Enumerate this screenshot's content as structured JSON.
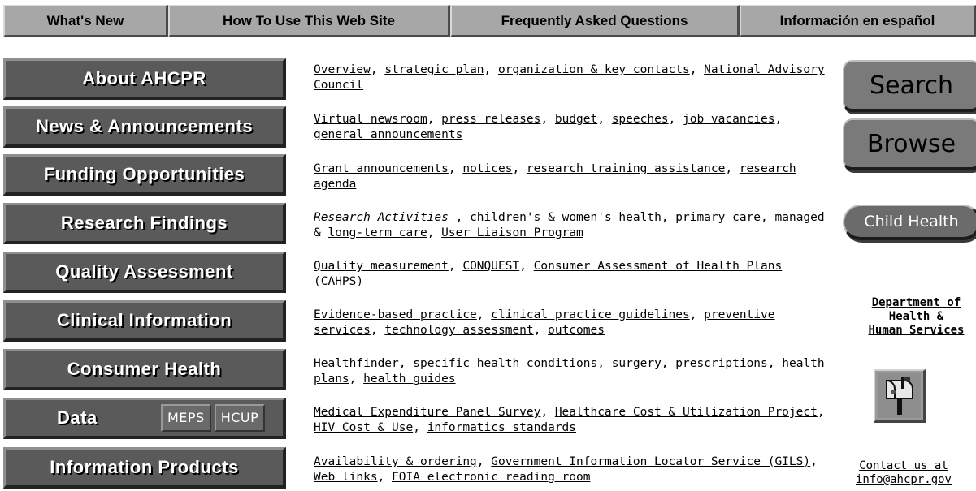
{
  "top_tabs": [
    {
      "label": "What's New"
    },
    {
      "label": "How To Use This Web Site"
    },
    {
      "label": "Frequently Asked Questions"
    },
    {
      "label": "Información en español"
    }
  ],
  "nav": {
    "about": "About AHCPR",
    "news": "News & Announcements",
    "funding": "Funding Opportunities",
    "research": "Research Findings",
    "quality": "Quality Assessment",
    "clinical": "Clinical Information",
    "consumer": "Consumer Health",
    "data": "Data",
    "meps": "MEPS",
    "hcup": "HCUP",
    "products": "Information Products"
  },
  "desc": {
    "about": {
      "l1": "Overview",
      "l2": "strategic plan",
      "l3": "organization & key contacts",
      "l4": "National Advisory Council"
    },
    "news": {
      "l1": "Virtual newsroom",
      "l2": "press releases",
      "l3": "budget",
      "l4": "speeches",
      "l5": "job vacancies",
      "l6": "general announcements"
    },
    "funding": {
      "l1": "Grant announcements",
      "l2": "notices",
      "l3": "research training assistance",
      "l4": "research agenda"
    },
    "research": {
      "l1": "Research Activities",
      "l2": "children's",
      "t1": "&",
      "l3": "women's health",
      "l4": "primary care",
      "l5": "managed",
      "t2": "&",
      "l6": "long-term care",
      "l7": "User Liaison Program"
    },
    "quality": {
      "l1": "Quality measurement",
      "l2": "CONQUEST",
      "l3": "Consumer Assessment of Health Plans (CAHPS)"
    },
    "clinical": {
      "l1": "Evidence-based practice",
      "l2": "clinical practice guidelines",
      "l3": "preventive services",
      "l4": "technology assessment",
      "l5": "outcomes"
    },
    "consumer": {
      "l1": "Healthfinder",
      "l2": "specific health conditions",
      "l3": "surgery",
      "l4": "prescriptions",
      "l5": "health plans",
      "l6": "health guides"
    },
    "data": {
      "l1": "Medical Expenditure Panel Survey",
      "l2": "Healthcare Cost & Utilization Project",
      "l3": "HIV Cost & Use",
      "l4": "informatics standards"
    },
    "products": {
      "l1": "Availability & ordering",
      "l2": "Government Information Locator Service (GILS)",
      "l3": "Web links",
      "l4": "FOIA electronic reading room"
    }
  },
  "right": {
    "search": "Search",
    "browse": "Browse",
    "child_health": "Child Health",
    "hhs_line1": "Department of",
    "hhs_line2": "Health &",
    "hhs_line3": "Human Services",
    "contact_line1": "Contact us at",
    "contact_line2": "info@ahcpr.gov",
    "mailbox_icon": "mailbox-icon"
  }
}
